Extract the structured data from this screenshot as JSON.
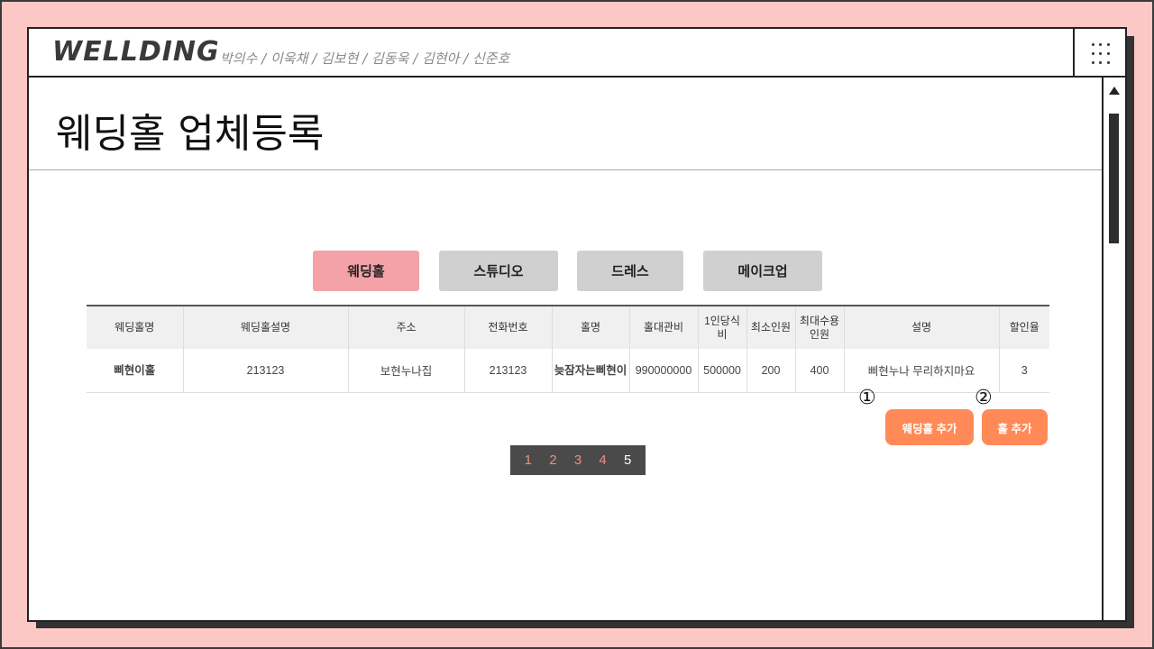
{
  "header": {
    "logo": "WELLDING",
    "members": "박의수 / 이욱채 / 김보현 / 김동욱 / 김현아 / 신준호"
  },
  "page_title": "웨딩홀 업체등록",
  "tabs": [
    {
      "label": "웨딩홀",
      "active": true
    },
    {
      "label": "스튜디오",
      "active": false
    },
    {
      "label": "드레스",
      "active": false
    },
    {
      "label": "메이크업",
      "active": false
    }
  ],
  "table": {
    "headers": [
      "웨딩홀명",
      "웨딩홀설명",
      "주소",
      "전화번호",
      "홀명",
      "홀대관비",
      "1인당식비",
      "최소인원",
      "최대수용인원",
      "설명",
      "할인율"
    ],
    "header_max_line1": "최대수용",
    "header_max_line2": "인원",
    "rows": [
      [
        "삐현이홀",
        "213123",
        "보현누나집",
        "213123",
        "늦잠자는삐현이",
        "990000000",
        "500000",
        "200",
        "400",
        "삐현누나 무리하지마요",
        "3"
      ]
    ]
  },
  "annotations": {
    "one": "①",
    "two": "②"
  },
  "actions": {
    "add_wedding_hall": "웨딩홀 추가",
    "add_hall": "홀 추가"
  },
  "pagination": {
    "pages": [
      "1",
      "2",
      "3",
      "4",
      "5"
    ],
    "current": "5"
  },
  "colors": {
    "background": "#fcc8c5",
    "active_tab": "#f4a2a8",
    "inactive_tab": "#d0d0d0",
    "action_button": "#ff8a57",
    "link_text": "#6f8fe6",
    "pager_bg": "#4a4a4a",
    "pager_text": "#f28a86"
  }
}
